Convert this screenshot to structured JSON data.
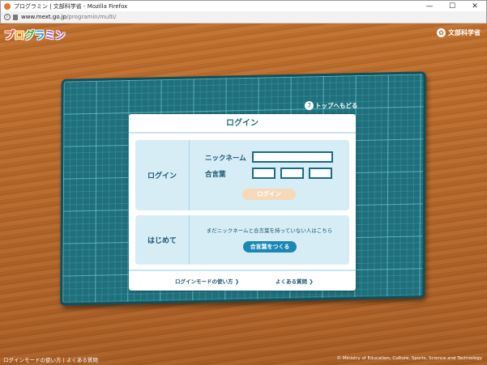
{
  "browser": {
    "title": "プログラミン | 文部科学省 - Mozilla Firefox",
    "minimize": "—",
    "maximize": "☐",
    "close": "✕",
    "url_host": "www.mext.go.jp",
    "url_path": "/programin/multi/"
  },
  "header": {
    "logo_chars": [
      "プ",
      "ロ",
      "グ",
      "ラ",
      "ミン"
    ],
    "ministry": "文部科学省"
  },
  "top_link": "トップへもどる",
  "dialog": {
    "title": "ログイン",
    "login": {
      "label": "ログイン",
      "nickname_label": "ニックネーム",
      "nickname_value": "",
      "password_label": "合言葉",
      "button": "ログイン"
    },
    "start": {
      "label": "はじめて",
      "note": "まだニックネームと合言葉を持っていない人はこちら",
      "button": "合言葉をつくる"
    },
    "footer": {
      "howto": "ログインモードの使い方 ❯",
      "faq": "よくある質問 ❯"
    }
  },
  "bottom": {
    "left": "ログインモードの使い方 | よくある質問",
    "copyright": "© Ministry of Education, Culture, Sports, Science and Technology"
  },
  "colors": {
    "wood": "#b8692a",
    "mat": "#1f6f7c",
    "panel": "#d6edf6",
    "accent": "#1a87b5",
    "login_button_disabled": "#f7d8b8"
  }
}
